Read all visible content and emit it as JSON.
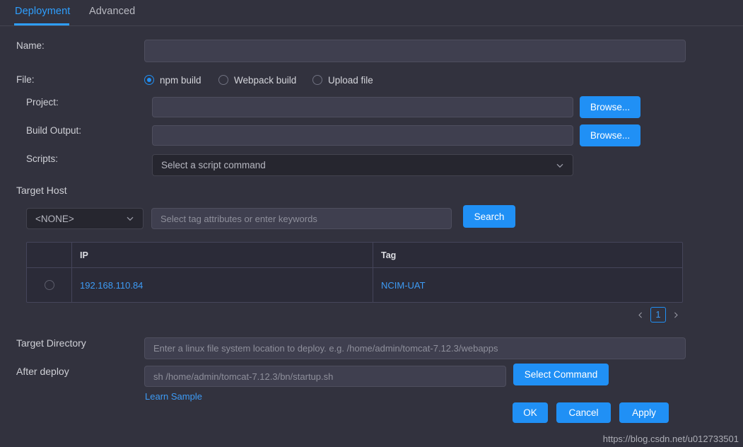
{
  "tabs": [
    {
      "label": "Deployment",
      "active": true
    },
    {
      "label": "Advanced",
      "active": false
    }
  ],
  "form": {
    "name_label": "Name:",
    "name_value": "",
    "name_placeholder": "",
    "file_label": "File:",
    "file_options": [
      {
        "label": "npm build",
        "selected": true
      },
      {
        "label": "Webpack build",
        "selected": false
      },
      {
        "label": "Upload file",
        "selected": false
      }
    ],
    "project_label": "Project:",
    "project_value": "",
    "project_browse_label": "Browse...",
    "build_output_label": "Build Output:",
    "build_output_value": "",
    "build_output_browse_label": "Browse...",
    "scripts_label": "Scripts:",
    "scripts_selected": "Select a script command",
    "scripts_icon": "chevron-down-icon"
  },
  "target_host": {
    "section_label": "Target Host",
    "host_select_value": "<NONE>",
    "host_select_icon": "chevron-down-icon",
    "search_placeholder": "Select tag attributes or enter keywords",
    "search_value": "",
    "search_button_label": "Search",
    "table": {
      "columns": [
        "",
        "IP",
        "Tag"
      ],
      "rows": [
        {
          "selected": false,
          "ip": "192.168.110.84",
          "tag": "NCIM-UAT"
        }
      ]
    },
    "pagination": {
      "prev_icon": "chevron-left-icon",
      "next_icon": "chevron-right-icon",
      "pages": [
        "1"
      ],
      "current": "1"
    }
  },
  "deploy": {
    "target_directory_label": "Target Directory",
    "target_directory_value": "",
    "target_directory_placeholder": "Enter a linux file system location to deploy. e.g. /home/admin/tomcat-7.12.3/webapps",
    "after_deploy_label": "After deploy",
    "after_deploy_value": "",
    "after_deploy_placeholder": "sh /home/admin/tomcat-7.12.3/bn/startup.sh",
    "select_command_label": "Select Command",
    "learn_sample_label": "Learn Sample"
  },
  "actions": {
    "ok_label": "OK",
    "cancel_label": "Cancel",
    "apply_label": "Apply"
  },
  "watermark": "https://blog.csdn.net/u012733501",
  "colors": {
    "background": "#32323e",
    "accent": "#2090f5",
    "link": "#3d9bf5",
    "input_fill": "#3f3f4f",
    "select_fill": "#26262f",
    "text": "#cfd0d6"
  }
}
